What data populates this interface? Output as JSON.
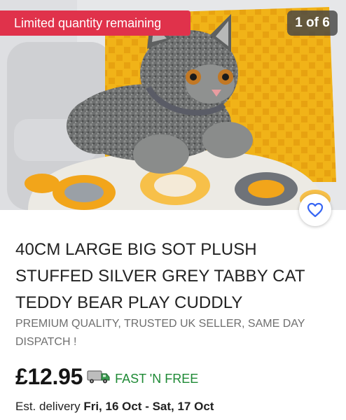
{
  "listing": {
    "badge": "Limited quantity remaining",
    "image_counter": "1 of 6",
    "title": "40CM LARGE BIG SOT PLUSH STUFFED SILVER GREY TABBY CAT TEDDY BEAR PLAY CUDDLY",
    "subtitle": "PREMIUM QUALITY, TRUSTED UK SELLER, SAME DAY DISPATCH !",
    "price": "£12.95",
    "shipping": "FAST 'N FREE",
    "delivery_label": "Est. delivery",
    "delivery_dates": "Fri, 16 Oct - Sat, 17 Oct"
  },
  "icons": {
    "watch": "heart-outline-icon",
    "shipping": "delivery-truck-icon"
  },
  "colors": {
    "badge_bg": "#e0324b",
    "counter_bg": "#464646",
    "shipping_text": "#1e8a35",
    "heart_accent": "#3665f3"
  }
}
